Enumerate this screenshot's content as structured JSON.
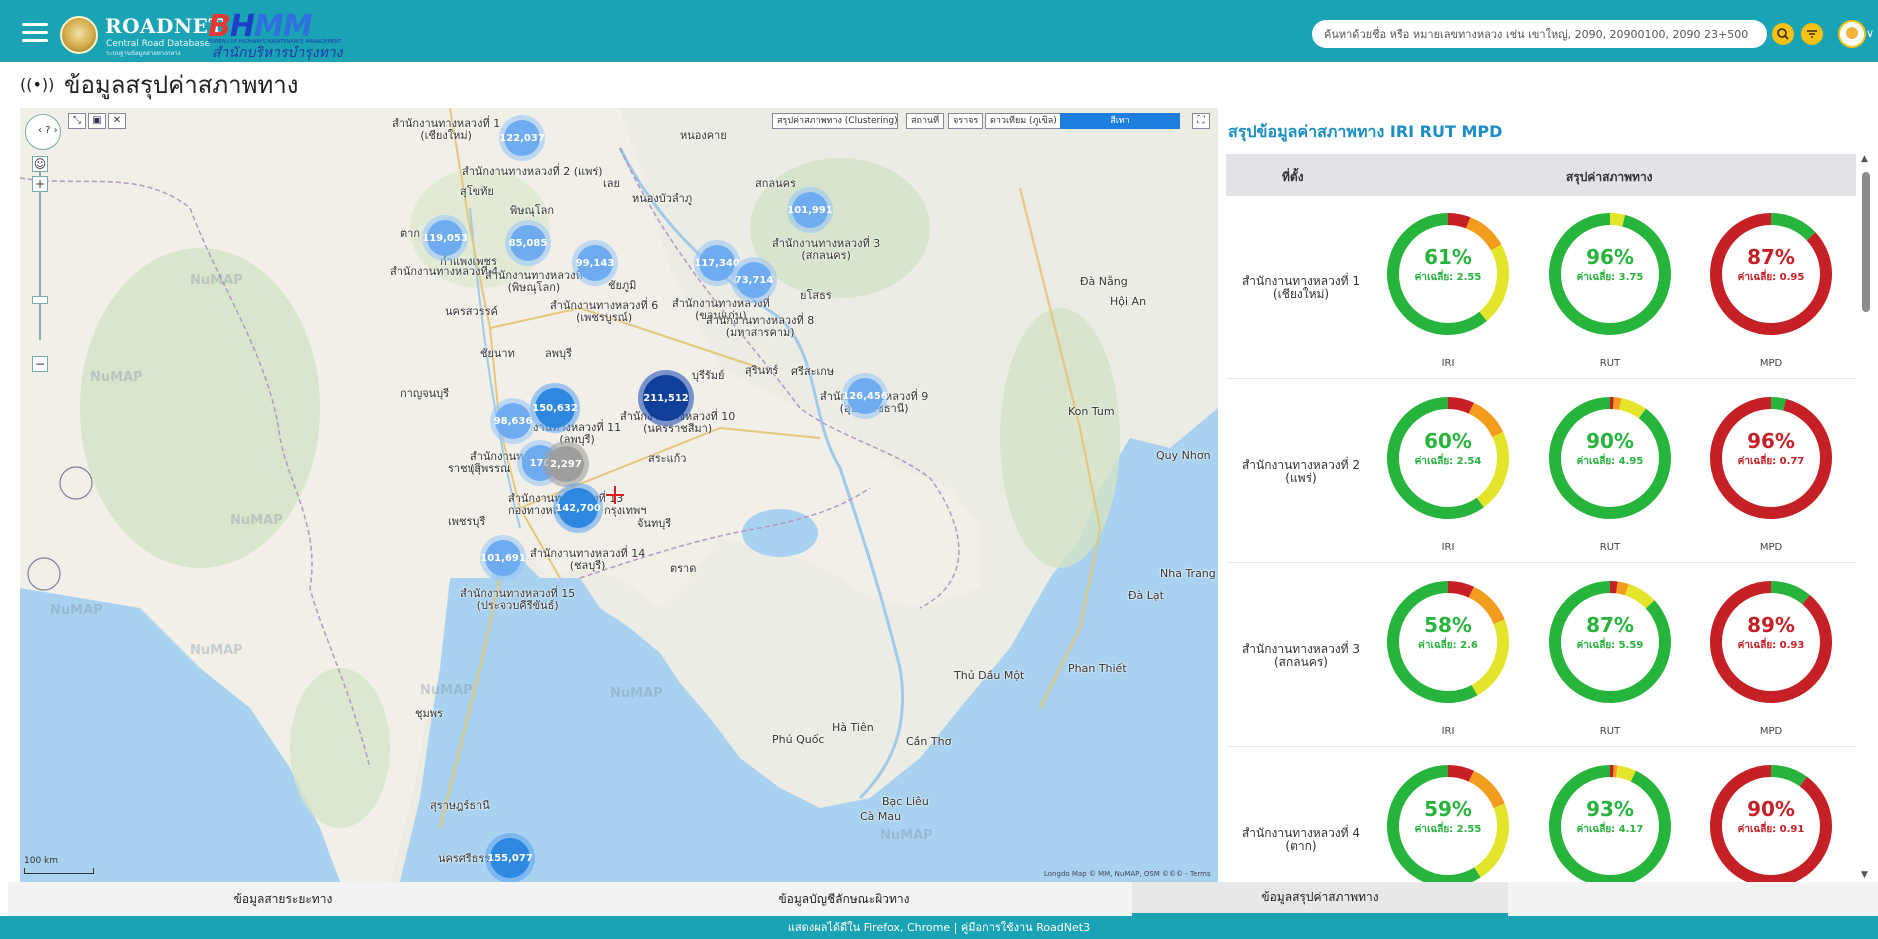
{
  "header": {
    "brand_main": "ROADNET",
    "brand_sub1": "Central Road Database",
    "brand_sub2": "ระบบฐานข้อมูลสายทางกลาง",
    "bhmm_b": "B",
    "bhmm_h": "H",
    "bhmm_mm": "MM",
    "bhmm_sub": "BUREAU OF HIGHWAYS MAINTENANCE MANAGEMENT",
    "bhmm_thai": "สำนักบริหารบำรุงทาง",
    "search_placeholder": "ค้นหาด้วยชื่อ หรือ หมายเลขทางหลวง เช่น เขาใหญ่, 2090, 20900100, 2090 23+500",
    "search_icon": "magnifier",
    "filter_icon": "filter-funnel",
    "avatar_caret": "∨"
  },
  "page": {
    "title": "ข้อมูลสรุปค่าสภาพทาง",
    "title_icon": "((•))"
  },
  "map": {
    "nav_glyph": "‹ ? ›",
    "zoom_in": "+",
    "zoom_out": "−",
    "tool_1": "⤡",
    "tool_2": "▣",
    "tool_3": "✕",
    "layer_select": "สรุปค่าสภาพทาง (Clustering)",
    "btn_place": "สถานที่",
    "btn_traffic": "จราจร",
    "btn_satellite": "ดาวเทียม (ภูเขิล)",
    "btn_color": "สีเทา",
    "fullscreen": "⛶",
    "scale": "100 km",
    "attribution": "Longdo Map © MM, NuMAP, OSM ©©© - Terms",
    "watermark": "NuMAP",
    "clusters": [
      {
        "value": "122,037",
        "size": "m"
      },
      {
        "value": "101,991",
        "size": "m"
      },
      {
        "value": "119,053",
        "size": "m"
      },
      {
        "value": "85,085",
        "size": "m"
      },
      {
        "value": "99,143",
        "size": "m"
      },
      {
        "value": "117,340",
        "size": "m"
      },
      {
        "value": "73,714",
        "size": "m"
      },
      {
        "value": "126,456",
        "size": "m"
      },
      {
        "value": "150,632",
        "size": "l"
      },
      {
        "value": "211,512",
        "size": "xl"
      },
      {
        "value": "98,636",
        "size": "m"
      },
      {
        "value": "170",
        "size": "m"
      },
      {
        "value": "2,297",
        "size": "g"
      },
      {
        "value": "142,700",
        "size": "l"
      },
      {
        "value": "101,691",
        "size": "m"
      },
      {
        "value": "155,077",
        "size": "l"
      }
    ],
    "labels": {
      "r1": "สำนักงานทางหลวงที่ 1\n(เชียงใหม่)",
      "r2": "สำนักงานทางหลวงที่ 2 (แพร่)",
      "r3": "สำนักงานทางหลวงที่ 3\n(สกลนคร)",
      "r4": "สำนักงานทางหลวงที่ 4",
      "r5": "สำนักงานทางหลวงที่\n(พิษณุโลก)",
      "r6": "สำนักงานทางหลวงที่ 6\n(เพชรบูรณ์)",
      "r7": "สำนักงานทางหลวงที่\n(ขอนแก่น)",
      "r8": "สำนักงานทางหลวงที่ 8\n(มหาสารคาม)",
      "r9": "สำนักงานทางหลวงที่ 9\n(อุบลราชธานี)",
      "r10": "สำนักงานทางหลวงที่ 10\n(นครราชสีมา)",
      "r11": "งานทางหลวงที่ 11\n(ลพบุรี)",
      "r12": "สำนักงานทางหลว\n(สุพรรณ",
      "r13": "สำนักงานทางหลวงที่ 13\nกองทางหลว           กรุงเทพฯ",
      "r14": "สำนักงานทางหลวงที่ 14\n(ชลบุรี)",
      "r15": "สำนักงานทางหลวงที่ 15\n(ประจวบคีรีขันธ์)",
      "city_nongkhai": "หนองคาย",
      "city_loei": "เลย",
      "city_udon": "หนองบัวลำภู",
      "city_sakon": "สกลนคร",
      "city_sukhothai": "สุโขทัย",
      "city_phitsanulok": "พิษณุโลก",
      "city_tak": "ตาก",
      "city_kpp": "กำแพงเพชร",
      "city_chaiyaphum": "ชัยภูมิ",
      "city_yasothon": "ยโสธร",
      "city_nakhonsawan": "นครสวรรค์",
      "city_chainat": "ชัยนาท",
      "city_lopburi": "ลพบุรี",
      "city_buriram": "บุรีรัมย์",
      "city_surin": "สุรินทร์",
      "city_sisaket": "ศรีสะเกษ",
      "city_kanchanaburi": "กาญจนบุรี",
      "city_ratchaburi": "ราชบุรี",
      "city_phetchaburi": "เพชรบุรี",
      "city_sakaeo": "สระแก้ว",
      "city_chanthaburi": "จันทบุรี",
      "city_trat": "ตราด",
      "city_chumphon": "ชุมพร",
      "city_suratthani": "สุราษฎร์ธานี",
      "city_nakhonsi": "นครศรีธรรม",
      "city_danang": "Đà Nẵng",
      "city_hoian": "Hội An",
      "city_kontum": "Kon Tum",
      "city_quynhon": "Quy Nhơn",
      "city_nhatrang": "Nha Trang",
      "city_dalat": "Đà Lạt",
      "city_phanthiet": "Phan Thiết",
      "city_thudaumot": "Thủ Dầu Một",
      "city_cantho": "Cần Thơ",
      "city_bacclieu": "Bạc Liêu",
      "city_camau": "Cà Mau",
      "city_phuquoc": "Phú Quốc",
      "city_hatien": "Hà Tiên"
    }
  },
  "panel": {
    "title": "สรุปข้อมูลค่าสภาพทาง IRI RUT MPD",
    "col_location": "ที่ตั้ง",
    "col_summary": "สรุปค่าสภาพทาง",
    "rows": [
      {
        "name": "สำนักงานทางหลวงที่ 1\n(เชียงใหม่)",
        "iri": {
          "pct": "61%",
          "avg": "ค่าเฉลี่ย: 2.55",
          "good": 61,
          "fair": 22,
          "poor": 11,
          "bad": 6
        },
        "rut": {
          "pct": "96%",
          "avg": "ค่าเฉลี่ย: 3.75",
          "good": 96,
          "fair": 4,
          "poor": 0,
          "bad": 0
        },
        "mpd": {
          "pct": "87%",
          "avg": "ค่าเฉลี่ย: 0.95",
          "good": 13,
          "bad": 87
        }
      },
      {
        "name": "สำนักงานทางหลวงที่ 2\n(แพร่)",
        "iri": {
          "pct": "60%",
          "avg": "ค่าเฉลี่ย: 2.54",
          "good": 60,
          "fair": 22,
          "poor": 11,
          "bad": 7
        },
        "rut": {
          "pct": "90%",
          "avg": "ค่าเฉลี่ย: 4.95",
          "good": 90,
          "fair": 7,
          "poor": 2,
          "bad": 1
        },
        "mpd": {
          "pct": "96%",
          "avg": "ค่าเฉลี่ย: 0.77",
          "good": 4,
          "bad": 96
        }
      },
      {
        "name": "สำนักงานทางหลวงที่ 3\n(สกลนคร)",
        "iri": {
          "pct": "58%",
          "avg": "ค่าเฉลี่ย: 2.6",
          "good": 58,
          "fair": 23,
          "poor": 12,
          "bad": 7
        },
        "rut": {
          "pct": "87%",
          "avg": "ค่าเฉลี่ย: 5.59",
          "good": 87,
          "fair": 8,
          "poor": 3,
          "bad": 2
        },
        "mpd": {
          "pct": "89%",
          "avg": "ค่าเฉลี่ย: 0.93",
          "good": 11,
          "bad": 89
        }
      },
      {
        "name": "สำนักงานทางหลวงที่ 4\n(ตาก)",
        "iri": {
          "pct": "59%",
          "avg": "ค่าเฉลี่ย: 2.55",
          "good": 59,
          "fair": 22,
          "poor": 12,
          "bad": 7
        },
        "rut": {
          "pct": "93%",
          "avg": "ค่าเฉลี่ย: 4.17",
          "good": 93,
          "fair": 5,
          "poor": 1,
          "bad": 1
        },
        "mpd": {
          "pct": "90%",
          "avg": "ค่าเฉลี่ย: 0.91",
          "good": 10,
          "bad": 90
        }
      }
    ],
    "caption_iri": "IRI",
    "caption_rut": "RUT",
    "caption_mpd": "MPD",
    "colors": {
      "good": "#27b43c",
      "fair": "#e3e52a",
      "poor": "#f29b1c",
      "bad": "#c62027"
    }
  },
  "tabs": [
    {
      "label": "ข้อมูลสายระยะทาง",
      "active": false
    },
    {
      "label": "ข้อมูลบัญชีลักษณะผิวทาง",
      "active": false
    },
    {
      "label": "ข้อมูลสรุปค่าสภาพทาง",
      "active": true
    }
  ],
  "footer": {
    "text": "แสดงผลได้ดีใน Firefox, Chrome | คู่มือการใช้งาน RoadNet3"
  }
}
